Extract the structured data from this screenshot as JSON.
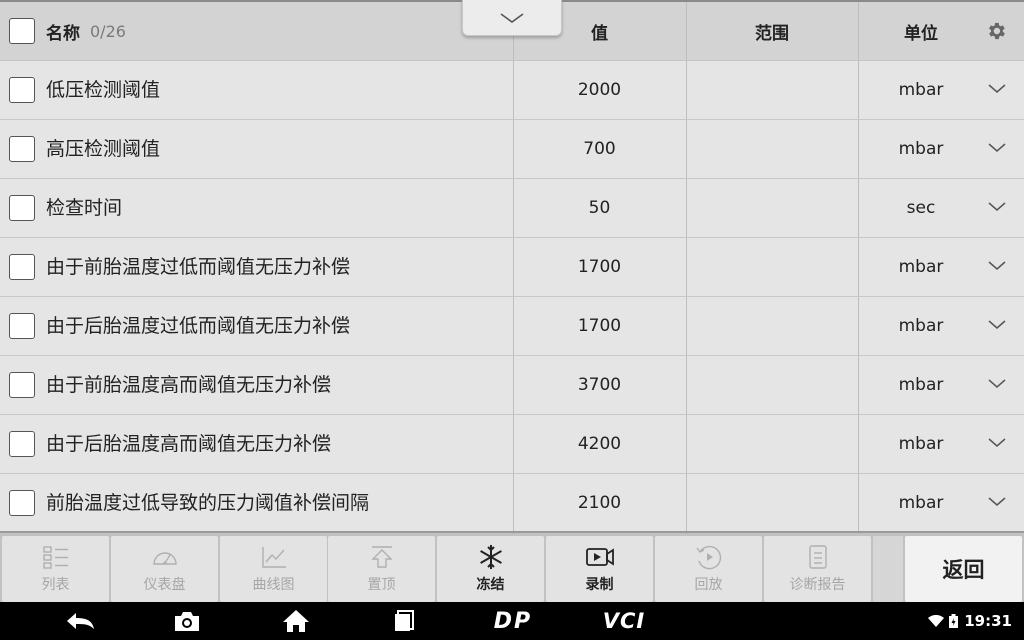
{
  "header": {
    "name_label": "名称",
    "count": "0/26",
    "value_label": "值",
    "range_label": "范围",
    "unit_label": "单位"
  },
  "rows": [
    {
      "name": "低压检测阈值",
      "value": "2000",
      "range": "",
      "unit": "mbar"
    },
    {
      "name": "高压检测阈值",
      "value": "700",
      "range": "",
      "unit": "mbar"
    },
    {
      "name": "检查时间",
      "value": "50",
      "range": "",
      "unit": "sec"
    },
    {
      "name": "由于前胎温度过低而阈值无压力补偿",
      "value": "1700",
      "range": "",
      "unit": "mbar"
    },
    {
      "name": "由于后胎温度过低而阈值无压力补偿",
      "value": "1700",
      "range": "",
      "unit": "mbar"
    },
    {
      "name": "由于前胎温度高而阈值无压力补偿",
      "value": "3700",
      "range": "",
      "unit": "mbar"
    },
    {
      "name": "由于后胎温度高而阈值无压力补偿",
      "value": "4200",
      "range": "",
      "unit": "mbar"
    },
    {
      "name": "前胎温度过低导致的压力阈值补偿间隔",
      "value": "2100",
      "range": "",
      "unit": "mbar"
    }
  ],
  "toolbar": {
    "list": "列表",
    "dashboard": "仪表盘",
    "graph": "曲线图",
    "pin_top": "置顶",
    "freeze": "冻结",
    "record": "录制",
    "playback": "回放",
    "report": "诊断报告",
    "back": "返回"
  },
  "navbar": {
    "brand1": "DP",
    "brand2": "VCI"
  },
  "status": {
    "time": "19:31"
  },
  "colors": {
    "header_bg": "#d3d3d3",
    "row_bg": "#e5e5e5",
    "toolbar_bg": "#c2c2c2",
    "disabled_text": "#a6a6a6"
  }
}
